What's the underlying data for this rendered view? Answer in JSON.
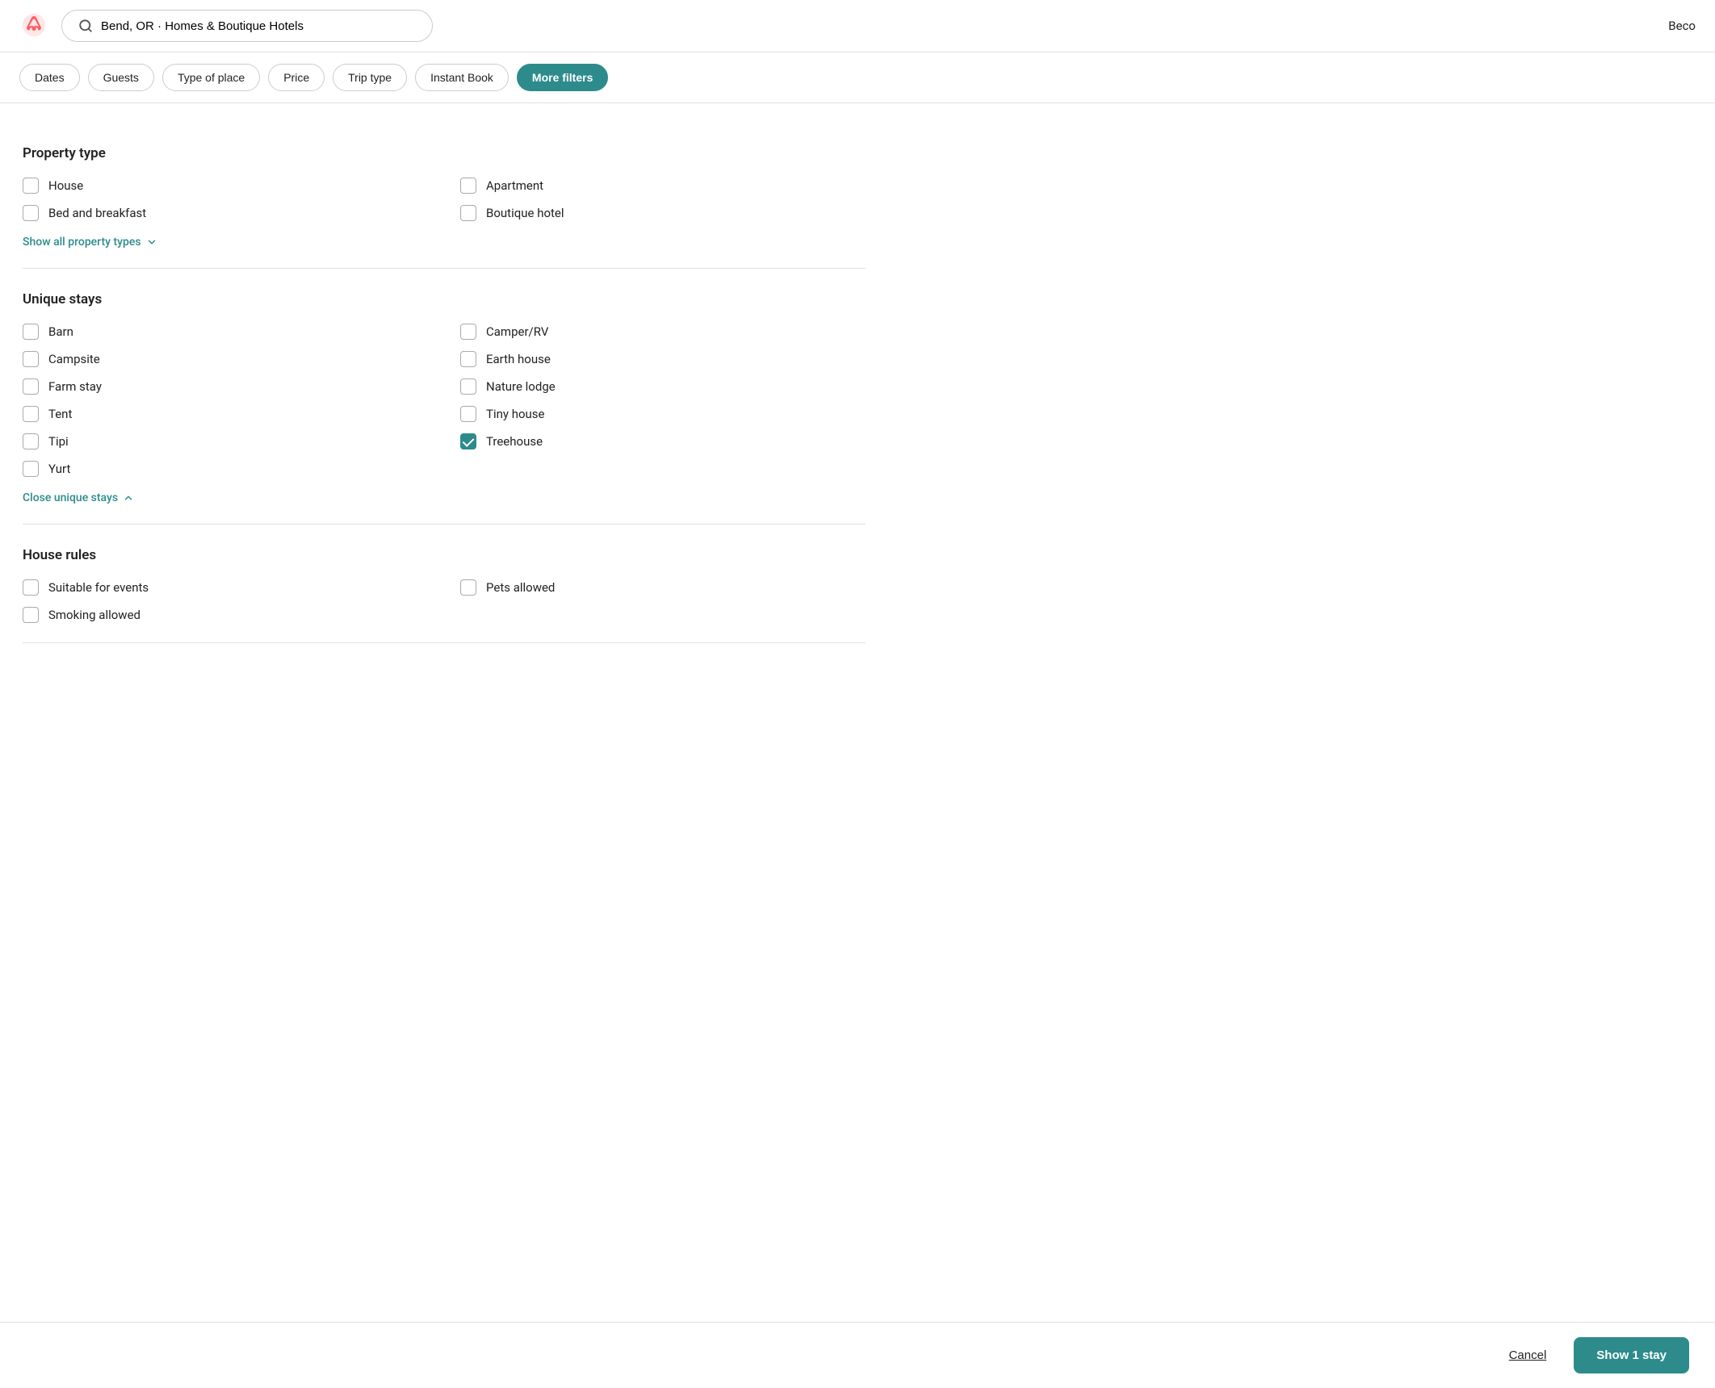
{
  "header": {
    "search_value": "Bend, OR · Homes & Boutique Hotels",
    "user_label": "Beco"
  },
  "filter_bar": {
    "buttons": [
      {
        "id": "dates",
        "label": "Dates",
        "active": false
      },
      {
        "id": "guests",
        "label": "Guests",
        "active": false
      },
      {
        "id": "type_of_place",
        "label": "Type of place",
        "active": false
      },
      {
        "id": "price",
        "label": "Price",
        "active": false
      },
      {
        "id": "trip_type",
        "label": "Trip type",
        "active": false
      },
      {
        "id": "instant_book",
        "label": "Instant Book",
        "active": false
      },
      {
        "id": "more_filters",
        "label": "More filters",
        "active": true
      }
    ]
  },
  "property_type_section": {
    "title": "Property type",
    "items_left": [
      {
        "id": "house",
        "label": "House",
        "checked": false
      },
      {
        "id": "bed_and_breakfast",
        "label": "Bed and breakfast",
        "checked": false
      }
    ],
    "items_right": [
      {
        "id": "apartment",
        "label": "Apartment",
        "checked": false
      },
      {
        "id": "boutique_hotel",
        "label": "Boutique hotel",
        "checked": false
      }
    ],
    "show_all_label": "Show all property types",
    "show_all_icon": "chevron-down"
  },
  "unique_stays_section": {
    "title": "Unique stays",
    "items_left": [
      {
        "id": "barn",
        "label": "Barn",
        "checked": false
      },
      {
        "id": "campsite",
        "label": "Campsite",
        "checked": false
      },
      {
        "id": "farm_stay",
        "label": "Farm stay",
        "checked": false
      },
      {
        "id": "tent",
        "label": "Tent",
        "checked": false
      },
      {
        "id": "tipi",
        "label": "Tipi",
        "checked": false
      },
      {
        "id": "yurt",
        "label": "Yurt",
        "checked": false
      }
    ],
    "items_right": [
      {
        "id": "camper_rv",
        "label": "Camper/RV",
        "checked": false
      },
      {
        "id": "earth_house",
        "label": "Earth house",
        "checked": false
      },
      {
        "id": "nature_lodge",
        "label": "Nature lodge",
        "checked": false
      },
      {
        "id": "tiny_house",
        "label": "Tiny house",
        "checked": false
      },
      {
        "id": "treehouse",
        "label": "Treehouse",
        "checked": true
      },
      {
        "id": "placeholder",
        "label": "",
        "checked": false
      }
    ],
    "close_label": "Close unique stays",
    "close_icon": "chevron-up"
  },
  "house_rules_section": {
    "title": "House rules",
    "items_left": [
      {
        "id": "suitable_for_events",
        "label": "Suitable for events",
        "checked": false
      },
      {
        "id": "smoking_allowed",
        "label": "Smoking allowed",
        "checked": false
      }
    ],
    "items_right": [
      {
        "id": "pets_allowed",
        "label": "Pets allowed",
        "checked": false
      }
    ]
  },
  "footer": {
    "cancel_label": "Cancel",
    "show_label": "Show 1 stay"
  },
  "colors": {
    "teal": "#2d8b8b",
    "teal_dark": "#236f6f"
  }
}
